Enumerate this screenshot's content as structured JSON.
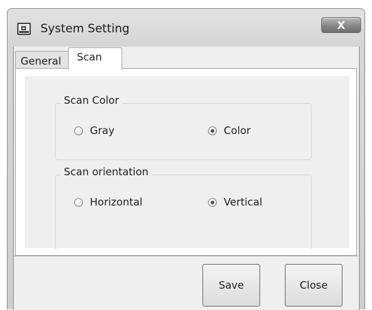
{
  "window": {
    "title": "System Setting",
    "close_glyph": "X",
    "app_icon": "settings-window-icon"
  },
  "tabs": [
    {
      "label": "General",
      "selected": false
    },
    {
      "label": "Scan",
      "selected": true
    }
  ],
  "scan_color": {
    "legend": "Scan Color",
    "options": [
      {
        "label": "Gray",
        "checked": false
      },
      {
        "label": "Color",
        "checked": true
      }
    ]
  },
  "scan_orientation": {
    "legend": "Scan orientation",
    "options": [
      {
        "label": "Horizontal",
        "checked": false
      },
      {
        "label": "Vertical",
        "checked": true
      }
    ]
  },
  "footer": {
    "save_label": "Save",
    "close_label": "Close"
  }
}
